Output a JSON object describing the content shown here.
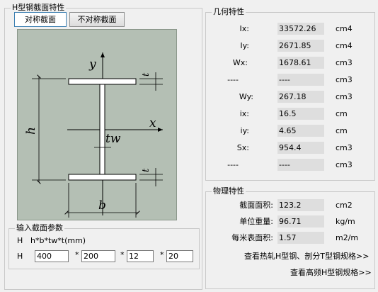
{
  "section_group": {
    "title": "H型钢截面特性"
  },
  "tabs": [
    {
      "label": "对称截面",
      "active": true
    },
    {
      "label": "不对称截面",
      "active": false
    }
  ],
  "drawing": {
    "y_label": "y",
    "x_label": "x",
    "h_label": "h",
    "b_label": "b",
    "t_label": "t",
    "tw_label": "tw"
  },
  "geometry": {
    "title": "几何特性",
    "rows": [
      {
        "label": "Ix:",
        "value": "33572.26",
        "unit": "cm4"
      },
      {
        "label": "Iy:",
        "value": "2671.85",
        "unit": "cm4"
      },
      {
        "label": "Wx:",
        "value": "1678.61",
        "unit": "cm3"
      },
      {
        "label": "----",
        "value": "----",
        "unit": "cm3"
      },
      {
        "label": "Wy:",
        "value": "267.18",
        "unit": "cm3"
      },
      {
        "label": "ix:",
        "value": "16.5",
        "unit": "cm"
      },
      {
        "label": "iy:",
        "value": "4.65",
        "unit": "cm"
      },
      {
        "label": "Sx:",
        "value": "954.4",
        "unit": "cm3"
      },
      {
        "label": "----",
        "value": "----",
        "unit": "cm3"
      }
    ]
  },
  "physical": {
    "title": "物理特性",
    "rows": [
      {
        "label": "截面面积:",
        "value": "123.2",
        "unit": "cm2"
      },
      {
        "label": "单位重量:",
        "value": "96.71",
        "unit": "kg/m"
      },
      {
        "label": "每米表面积:",
        "value": "1.57",
        "unit": "m2/m"
      }
    ],
    "link1": "查看热轧H型钢、剖分T型钢规格>>",
    "link2": "查看高频H型钢规格>>"
  },
  "params": {
    "title": "输入截面参数",
    "formula_prefix": "H",
    "formula": "h*b*tw*t(mm)",
    "row_label": "H",
    "sep": "*",
    "values": [
      "400",
      "200",
      "12",
      "20"
    ]
  }
}
